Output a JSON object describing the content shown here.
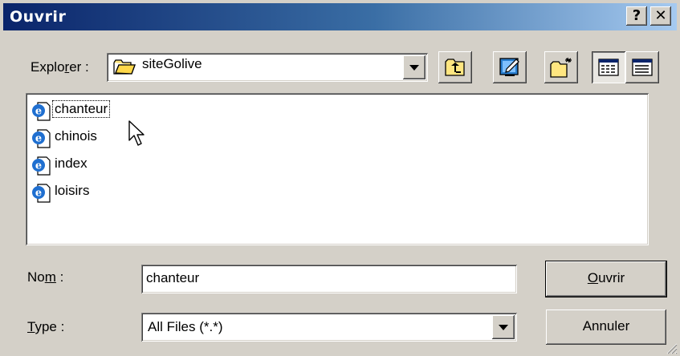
{
  "window": {
    "title": "Ouvrir",
    "help_glyph": "?",
    "close_glyph": "✕"
  },
  "look_in": {
    "label_pre": "Explo",
    "label_ul": "r",
    "label_post": "er :",
    "value": "siteGolive"
  },
  "toolbar": {
    "up_icon": "folder-up-icon",
    "desktop_icon": "desktop-icon",
    "new_folder_icon": "new-folder-icon",
    "list_icon": "list-view-icon",
    "details_icon": "details-view-icon"
  },
  "files": [
    {
      "name": "chanteur",
      "icon": "ie-document-icon",
      "focused": true
    },
    {
      "name": "chinois",
      "icon": "ie-document-icon",
      "focused": false
    },
    {
      "name": "index",
      "icon": "ie-document-icon",
      "focused": false
    },
    {
      "name": "loisirs",
      "icon": "ie-document-icon",
      "focused": false
    }
  ],
  "name_field": {
    "label_pre": "No",
    "label_ul": "m",
    "label_post": " :",
    "value": "chanteur"
  },
  "type_field": {
    "label_ul": "T",
    "label_post": "ype :",
    "value": "All Files (*.*)"
  },
  "buttons": {
    "open_ul": "O",
    "open_post": "uvrir",
    "cancel": "Annuler"
  }
}
